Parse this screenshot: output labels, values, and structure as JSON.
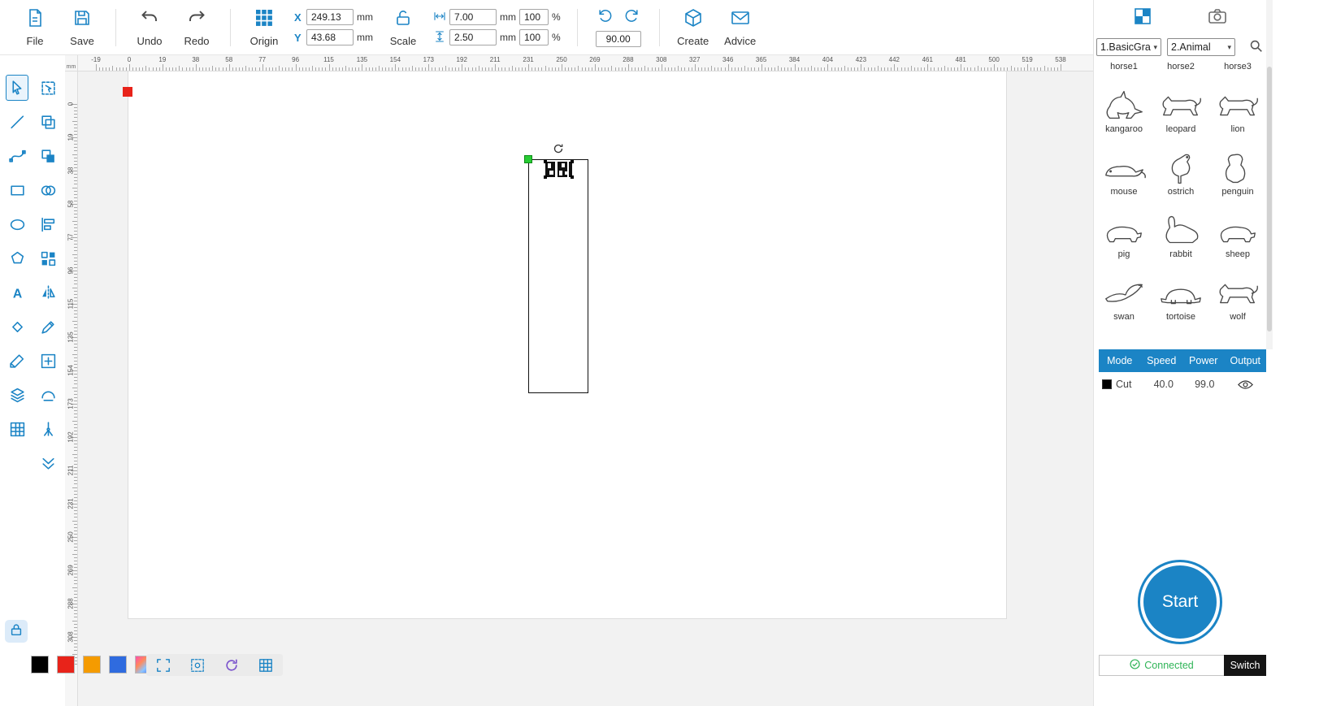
{
  "topbar": {
    "file": "File",
    "save": "Save",
    "undo": "Undo",
    "redo": "Redo",
    "origin": "Origin",
    "scale": "Scale",
    "create": "Create",
    "advice": "Advice",
    "x_label": "X",
    "y_label": "Y",
    "x_value": "249.13",
    "y_value": "43.68",
    "unit": "mm",
    "percent": "%",
    "width_value": "7.00",
    "width_percent": "100",
    "height_value": "2.50",
    "height_percent": "100",
    "rotation_value": "90.00"
  },
  "left_toolbar": {
    "active": "select-tool",
    "column1": [
      "select-tool",
      "line-tool",
      "curve-tool",
      "rectangle-tool",
      "ellipse-tool",
      "polygon-tool",
      "text-tool",
      "eraser-tool",
      "knife-tool",
      "layers-tool",
      "array-tool"
    ],
    "column2": [
      "node-select-tool",
      "duplicate-tool",
      "clone-tool",
      "boolean-tool",
      "align-tool",
      "grid-group-tool",
      "mirror-tool",
      "edit-tool",
      "grid-add-tool",
      "weld-tool",
      "laser-tool",
      "drop-anchor-tool"
    ]
  },
  "rulers": {
    "unit": "mm",
    "top_labels": [
      "-19",
      "0",
      "19",
      "38",
      "58",
      "77",
      "96",
      "115",
      "135",
      "154",
      "173",
      "192",
      "211",
      "231",
      "250",
      "269",
      "288",
      "308",
      "327",
      "346",
      "365",
      "384",
      "404",
      "423",
      "442",
      "461",
      "481",
      "500",
      "519",
      "538"
    ],
    "left_labels": [
      "0",
      "19",
      "38",
      "58",
      "77",
      "96",
      "115",
      "135",
      "154",
      "173",
      "192",
      "211",
      "231",
      "250",
      "269",
      "288",
      "308"
    ]
  },
  "palette": [
    {
      "name": "black",
      "color": "#000000"
    },
    {
      "name": "red",
      "color": "#e8231a"
    },
    {
      "name": "orange",
      "color": "#f59b00"
    },
    {
      "name": "blue",
      "color": "#2f6bdf"
    },
    {
      "name": "multicolor",
      "color": "gradient"
    }
  ],
  "bottom_tools": [
    "frame-tool",
    "preview-tool",
    "refresh-tool",
    "grid-tool"
  ],
  "library": {
    "category1": "1.BasicGra",
    "category2": "2.Animal",
    "items": [
      {
        "name": "horse1",
        "icon": "quadruped"
      },
      {
        "name": "horse2",
        "icon": "quadruped"
      },
      {
        "name": "horse3",
        "icon": "quadruped"
      },
      {
        "name": "kangaroo",
        "icon": "kangaroo"
      },
      {
        "name": "leopard",
        "icon": "feline"
      },
      {
        "name": "lion",
        "icon": "feline"
      },
      {
        "name": "mouse",
        "icon": "mouse"
      },
      {
        "name": "ostrich",
        "icon": "ostrich"
      },
      {
        "name": "penguin",
        "icon": "penguin"
      },
      {
        "name": "pig",
        "icon": "pig"
      },
      {
        "name": "rabbit",
        "icon": "rabbit"
      },
      {
        "name": "sheep",
        "icon": "pig"
      },
      {
        "name": "swan",
        "icon": "swan"
      },
      {
        "name": "tortoise",
        "icon": "tortoise"
      },
      {
        "name": "wolf",
        "icon": "feline"
      }
    ]
  },
  "process_table": {
    "headers": [
      "Mode",
      "Speed",
      "Power",
      "Output"
    ],
    "rows": [
      {
        "mode": "Cut",
        "color": "#000000",
        "speed": "40.0",
        "power": "99.0"
      }
    ]
  },
  "start_button": "Start",
  "statusbar": {
    "connected": "Connected",
    "switch": "Switch"
  },
  "colors": {
    "accent": "#1b84c5",
    "connected_green": "#2fb457",
    "selection_red": "#e8231a"
  }
}
